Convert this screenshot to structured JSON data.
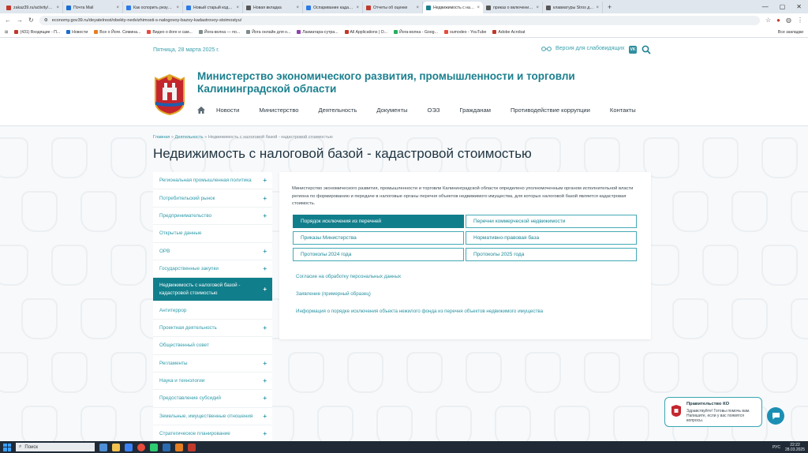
{
  "browser": {
    "tabs": [
      {
        "title": "zakaz39.ru/activity/zakaz/v",
        "color": "#c0392b"
      },
      {
        "title": "Почта Mail",
        "color": "#1a6dd1"
      },
      {
        "title": "Как оспорить результаты кад",
        "color": "#2c7be5"
      },
      {
        "title": "Новый старый кодекс, или",
        "color": "#2c7be5"
      },
      {
        "title": "Новая вкладка",
        "color": "#555555"
      },
      {
        "title": "Оспаривание кадастровой с",
        "color": "#2c7be5"
      },
      {
        "title": "Отчеты об оценке",
        "color": "#c0392b"
      },
      {
        "title": "Недвижимость с налоговой",
        "color": "#1b7f8e",
        "active": true
      },
      {
        "title": "приказ о включении в перечень",
        "color": "#555555"
      },
      {
        "title": "клавиатуры Stros для мака",
        "color": "#555555"
      }
    ],
    "url": "economy.gov39.ru/deyatelnost/obekty-nedvizhimosti-s-nalogovoy-bazoy-kadastrovoy-stoimostyu/",
    "bookmarks": [
      {
        "label": "(431) Входящие - П...",
        "color": "#c0392b"
      },
      {
        "label": "Новости",
        "color": "#1a6dd1"
      },
      {
        "label": "Все о Йоге. Семина...",
        "color": "#e67e22"
      },
      {
        "label": "Видео о йоге и сам...",
        "color": "#e74c3c"
      },
      {
        "label": "Йога-волна — по...",
        "color": "#7f8c8d"
      },
      {
        "label": "Йога онлайн для н...",
        "color": "#7f8c8d"
      },
      {
        "label": "Лакматара-сутра...",
        "color": "#8e44ad"
      },
      {
        "label": "All Applications | O...",
        "color": "#c0392b"
      },
      {
        "label": "Йога-волна - Goog...",
        "color": "#27ae60"
      },
      {
        "label": "oumodeo - YouTube",
        "color": "#e74c3c"
      },
      {
        "label": "Adobe Acrobat",
        "color": "#c0392b"
      }
    ],
    "all_bookmarks": "Все закладки"
  },
  "header": {
    "date": "Пятница, 28 марта 2025 г.",
    "vision_label": "Версия для слабовидящих",
    "vk_label": "VK",
    "org_title": "Министерство экономического развития, промышленности и торговли Калининградской области",
    "nav": [
      "Новости",
      "Министерство",
      "Деятельность",
      "Документы",
      "ОЭЗ",
      "Гражданам",
      "Противодействие коррупции",
      "Контакты"
    ]
  },
  "breadcrumbs": {
    "home": "Главная",
    "sep": "»",
    "section": "Деятельность",
    "current": "Недвижимость с налоговой базой - кадастровой стоимостью"
  },
  "page_title": "Недвижимость с налоговой базой - кадастровой стоимостью",
  "sidebar": [
    {
      "label": "Региональная промышленная политика",
      "plus": true
    },
    {
      "label": "Потребительский рынок",
      "plus": true
    },
    {
      "label": "Предпринимательство",
      "plus": true
    },
    {
      "label": "Открытые данные",
      "plus": false
    },
    {
      "label": "ОРВ",
      "plus": true
    },
    {
      "label": "Государственные закупки",
      "plus": true
    },
    {
      "label": "Недвижимость с налоговой базой - кадастровой стоимостью",
      "plus": true,
      "active": true
    },
    {
      "label": "Антитеррор",
      "plus": false
    },
    {
      "label": "Проектная деятельность",
      "plus": true
    },
    {
      "label": "Общественный совет",
      "plus": false
    },
    {
      "label": "Регламенты",
      "plus": true
    },
    {
      "label": "Наука и технологии",
      "plus": true
    },
    {
      "label": "Предоставление субсидий",
      "plus": true
    },
    {
      "label": "Земельные, имущественные отношения",
      "plus": true
    },
    {
      "label": "Стратегическое планирование",
      "plus": true
    }
  ],
  "content": {
    "intro": "Министерство экономического развития, промышленности и торговли Калининградской области определено уполномоченным органом исполнительной власти региона по формированию и передаче в налоговые органы перечня объектов недвижимого имущества, для которых налоговой базой является кадастровая стоимость.",
    "buttons": [
      "Порядок исключения из перечней",
      "Перечни коммерческой недвижимости",
      "Приказы Министерства",
      "Нормативно-правовая база",
      "Протоколы 2024 года",
      "Протоколы 2025 года"
    ],
    "links": [
      "Согласие на обработку персональных данных",
      "Заявление (примерный образец)",
      "Информация о порядке исключения объекта нежилого фонда из перечня объектов недвижимого имущества"
    ]
  },
  "chat": {
    "title": "Правительство КО",
    "message": "Здравствуйте! Готовы помочь вам. Напишите, если у вас появятся вопросы."
  },
  "taskbar": {
    "search": "Поиск",
    "lang": "РУС",
    "time": "22:22",
    "date": "28.03.2025"
  },
  "colors": {
    "accent": "#117e8b",
    "link": "#2a93a2",
    "title": "#1b7f8e"
  }
}
